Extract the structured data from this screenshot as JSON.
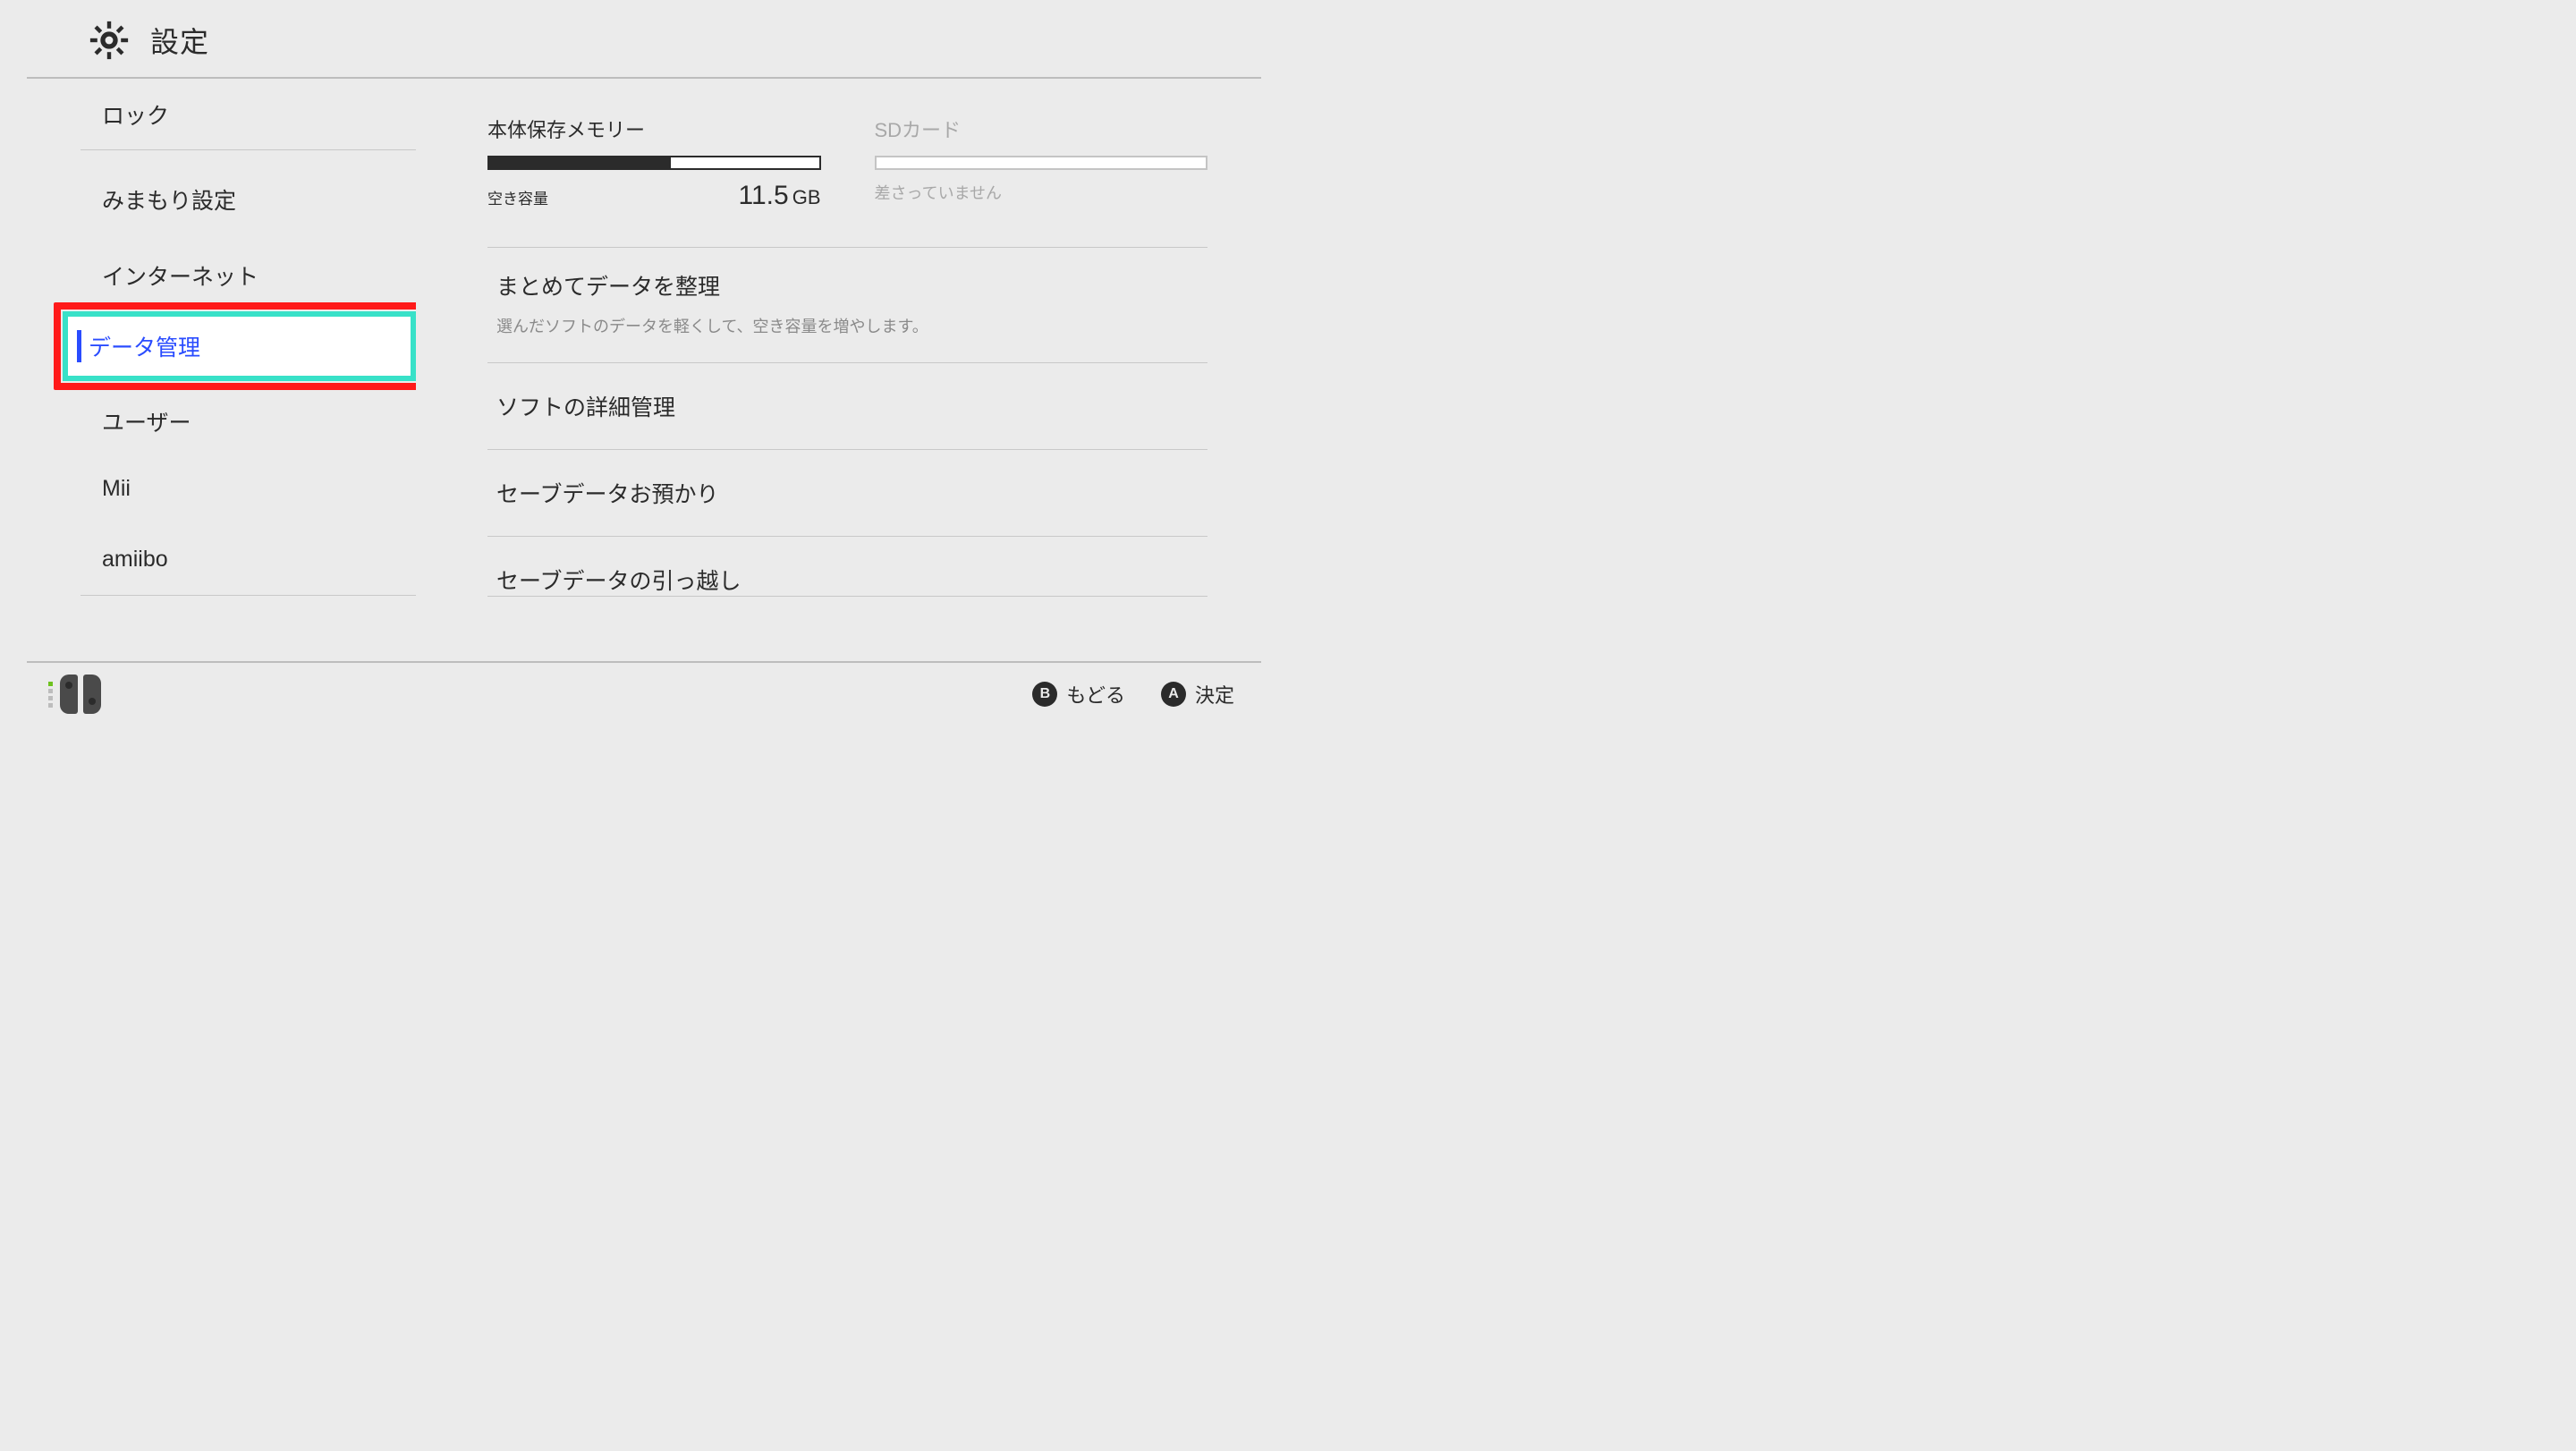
{
  "header": {
    "title": "設定"
  },
  "sidebar": {
    "items": [
      {
        "label": "ロック"
      },
      {
        "label": "みまもり設定"
      },
      {
        "label": "インターネット"
      },
      {
        "label": "データ管理",
        "selected": true
      },
      {
        "label": "ユーザー"
      },
      {
        "label": "Mii"
      },
      {
        "label": "amiibo"
      }
    ]
  },
  "storage": {
    "internal": {
      "label": "本体保存メモリー",
      "free_label": "空き容量",
      "free_value": "11.5",
      "free_unit": "GB",
      "used_percent": 55
    },
    "sd": {
      "label": "SDカード",
      "status": "差さっていません"
    }
  },
  "menu": {
    "items": [
      {
        "title": "まとめてデータを整理",
        "desc": "選んだソフトのデータを軽くして、空き容量を増やします。"
      },
      {
        "title": "ソフトの詳細管理"
      },
      {
        "title": "セーブデータお預かり"
      },
      {
        "title": "セーブデータの引っ越し"
      }
    ]
  },
  "footer": {
    "back": {
      "button": "B",
      "label": "もどる"
    },
    "select": {
      "button": "A",
      "label": "決定"
    }
  }
}
